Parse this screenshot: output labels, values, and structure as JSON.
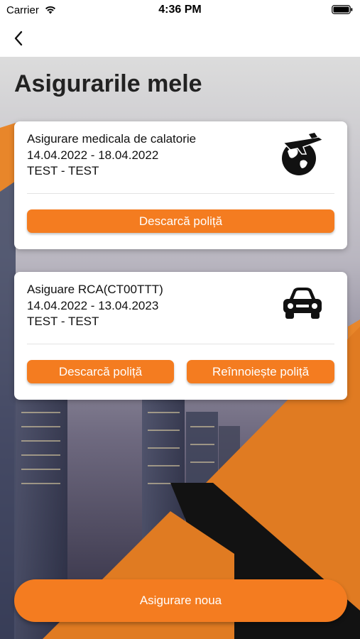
{
  "status_bar": {
    "carrier": "Carrier",
    "time": "4:36 PM",
    "wifi_icon": "wifi-icon",
    "battery_icon": "battery-icon"
  },
  "nav": {
    "back_icon": "chevron-left-icon"
  },
  "page": {
    "title": "Asigurarile mele"
  },
  "policies": [
    {
      "title": "Asigurare medicala de calatorie",
      "dates": "14.04.2022 - 18.04.2022",
      "holder": "TEST - TEST",
      "icon": "travel-globe-plane-icon",
      "buttons": [
        "Descarcă poliță"
      ]
    },
    {
      "title": "Asiguare RCA(CT00TTT)",
      "dates": "14.04.2022 - 13.04.2023",
      "holder": "TEST - TEST",
      "icon": "car-icon",
      "buttons": [
        "Descarcă poliță",
        "Reînnoiește poliță"
      ]
    }
  ],
  "footer": {
    "new_button": "Asigurare noua"
  },
  "colors": {
    "accent": "#f47c20",
    "card_background": "#ffffff",
    "title_text": "#222222"
  }
}
